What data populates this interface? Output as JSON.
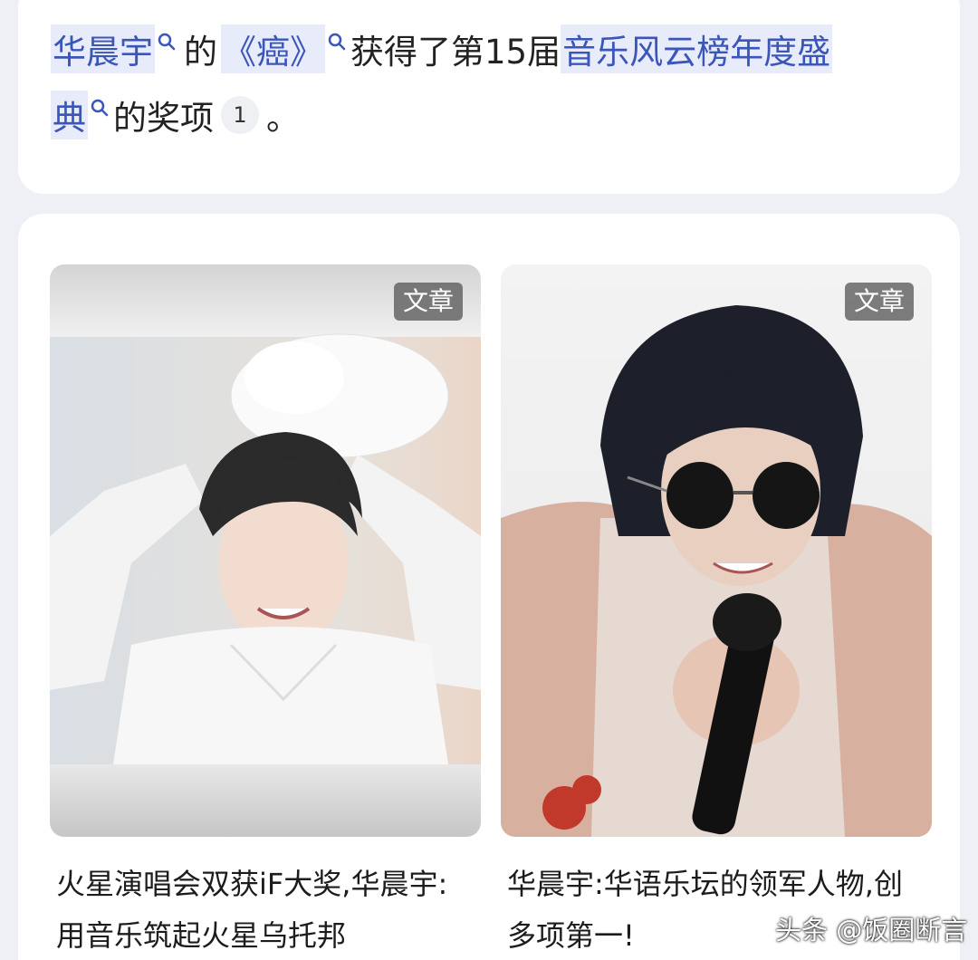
{
  "answer": {
    "line1": {
      "artist": "华晨宇",
      "particle_of": "的",
      "song": "《癌》",
      "verb": "获得了第15届",
      "event_part1": "音乐风云榜年度盛"
    },
    "line2": {
      "event_part2": "典",
      "suffix": "的奖项",
      "citation": "1",
      "period": "。"
    },
    "colors": {
      "link": "#3a56b8",
      "highlight": "#e8ebfa"
    }
  },
  "results": [
    {
      "badge": "文章",
      "title": "火星演唱会双获iF大奖,华晨宇:用音乐筑起火星乌托邦",
      "image_icon": "portrait-white-outfit"
    },
    {
      "badge": "文章",
      "title": "华晨宇:华语乐坛的领军人物,创多项第一!",
      "image_icon": "portrait-sunglasses-microphone"
    }
  ],
  "watermark": "头条 @饭圈断言"
}
